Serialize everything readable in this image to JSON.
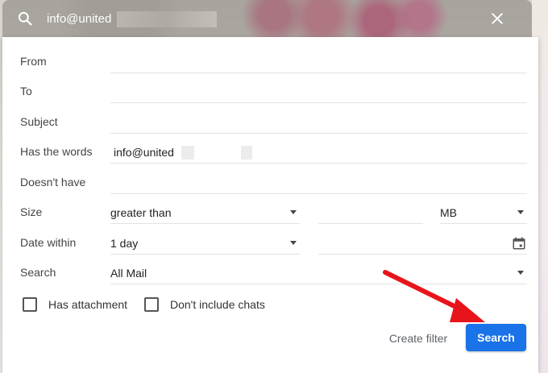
{
  "search_bar": {
    "query": "info@united",
    "search_icon": "search-icon",
    "close_icon": "close-icon"
  },
  "form": {
    "from_label": "From",
    "to_label": "To",
    "subject_label": "Subject",
    "has_words_label": "Has the words",
    "has_words_value": "info@united",
    "doesnt_have_label": "Doesn't have",
    "size_label": "Size",
    "size_operator": "greater than",
    "size_unit": "MB",
    "date_within_label": "Date within",
    "date_within_value": "1 day",
    "search_label": "Search",
    "search_scope": "All Mail"
  },
  "checkboxes": {
    "has_attachment": "Has attachment",
    "no_chats": "Don't include chats"
  },
  "buttons": {
    "create_filter": "Create filter",
    "search": "Search"
  },
  "colors": {
    "accent": "#1a73e8",
    "annotation_arrow": "#e8141c"
  },
  "icons": {
    "calendar": "calendar-icon",
    "dropdown": "chevron-down-icon"
  }
}
